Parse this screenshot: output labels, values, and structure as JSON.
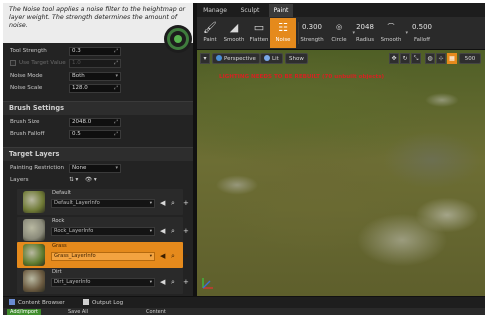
{
  "tooltip": {
    "text": "The Noise tool applies a noise filter to the heightmap or layer weight. The strength determines the amount of noise."
  },
  "tool_settings": {
    "tool_strength_label": "Tool Strength",
    "tool_strength_value": "0.3",
    "use_target_value_label": "Use Target Value",
    "use_target_value_value": "1.0",
    "noise_mode_label": "Noise Mode",
    "noise_mode_value": "Both",
    "noise_scale_label": "Noise Scale",
    "noise_scale_value": "128.0"
  },
  "brush_settings": {
    "header": "Brush Settings",
    "brush_size_label": "Brush Size",
    "brush_size_value": "2048.0",
    "brush_falloff_label": "Brush Falloff",
    "brush_falloff_value": "0.5"
  },
  "target_layers": {
    "header": "Target Layers",
    "painting_restriction_label": "Painting Restriction",
    "painting_restriction_value": "None",
    "layers_label": "Layers",
    "layers": [
      {
        "name": "Default",
        "info": "Default_LayerInfo",
        "thumb_color": "#6f7a35",
        "selected": false
      },
      {
        "name": "Rock",
        "info": "Rock_LayerInfo",
        "thumb_color": "#8a8a7a",
        "selected": false
      },
      {
        "name": "Grass",
        "info": "Grass_LayerInfo",
        "thumb_color": "#5d7a2c",
        "selected": true
      },
      {
        "name": "Dirt",
        "info": "Dirt_LayerInfo",
        "thumb_color": "#6b5a40",
        "selected": false
      }
    ]
  },
  "mode_tabs": {
    "manage": "Manage",
    "sculpt": "Sculpt",
    "paint": "Paint"
  },
  "tools": {
    "paint": "Paint",
    "smooth": "Smooth",
    "flatten": "Flatten",
    "noise": "Noise",
    "strength_value": "0.300",
    "strength_label": "Strength",
    "circle_label": "Circle",
    "radius_value": "2048",
    "radius_label": "Radius",
    "smooth_label": "Smooth",
    "falloff_value": "0.500",
    "falloff_label": "Falloff"
  },
  "viewport": {
    "perspective": "Perspective",
    "lit": "Lit",
    "show": "Show",
    "grid_snap": "500",
    "warning": "LIGHTING NEEDS TO BE REBUILT (70 unbuilt objects)"
  },
  "bottom_tabs": {
    "content_browser": "Content Browser",
    "output_log": "Output Log"
  },
  "below_strip": {
    "add_import": "Add/Import",
    "save_all": "Save All",
    "content": "Content"
  },
  "colors": {
    "accent": "#e58a1c",
    "warning": "#d52222",
    "panel": "#232323"
  }
}
